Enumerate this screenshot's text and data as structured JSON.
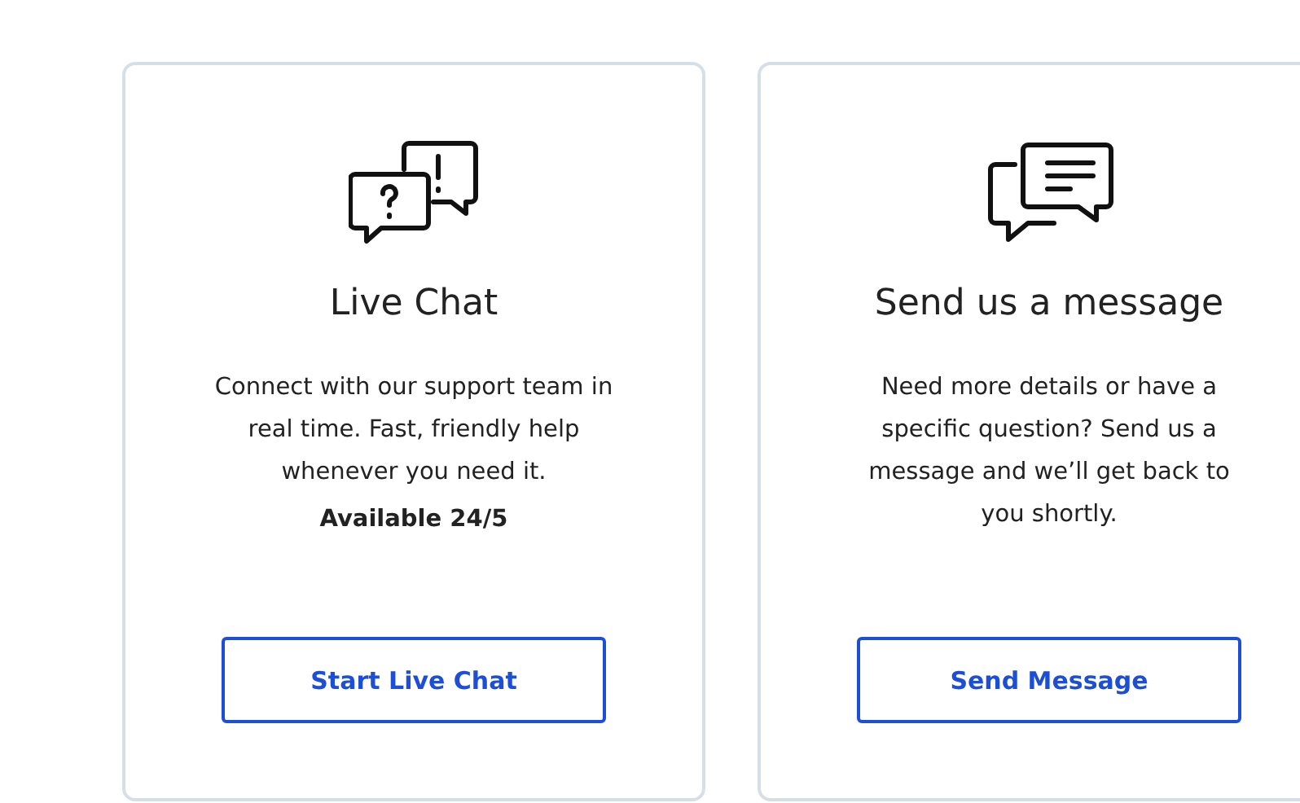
{
  "cards": [
    {
      "kind": "chat",
      "title": "Live Chat",
      "description": "Connect with our support team in real time. Fast, friendly help whenever you need it.",
      "availability": "Available 24/5",
      "button": "Start Live Chat"
    },
    {
      "kind": "message",
      "title": "Send us a message",
      "description": "Need more details or have a specific question? Send us a message and we’ll get back to you shortly.",
      "button": "Send Message"
    }
  ]
}
